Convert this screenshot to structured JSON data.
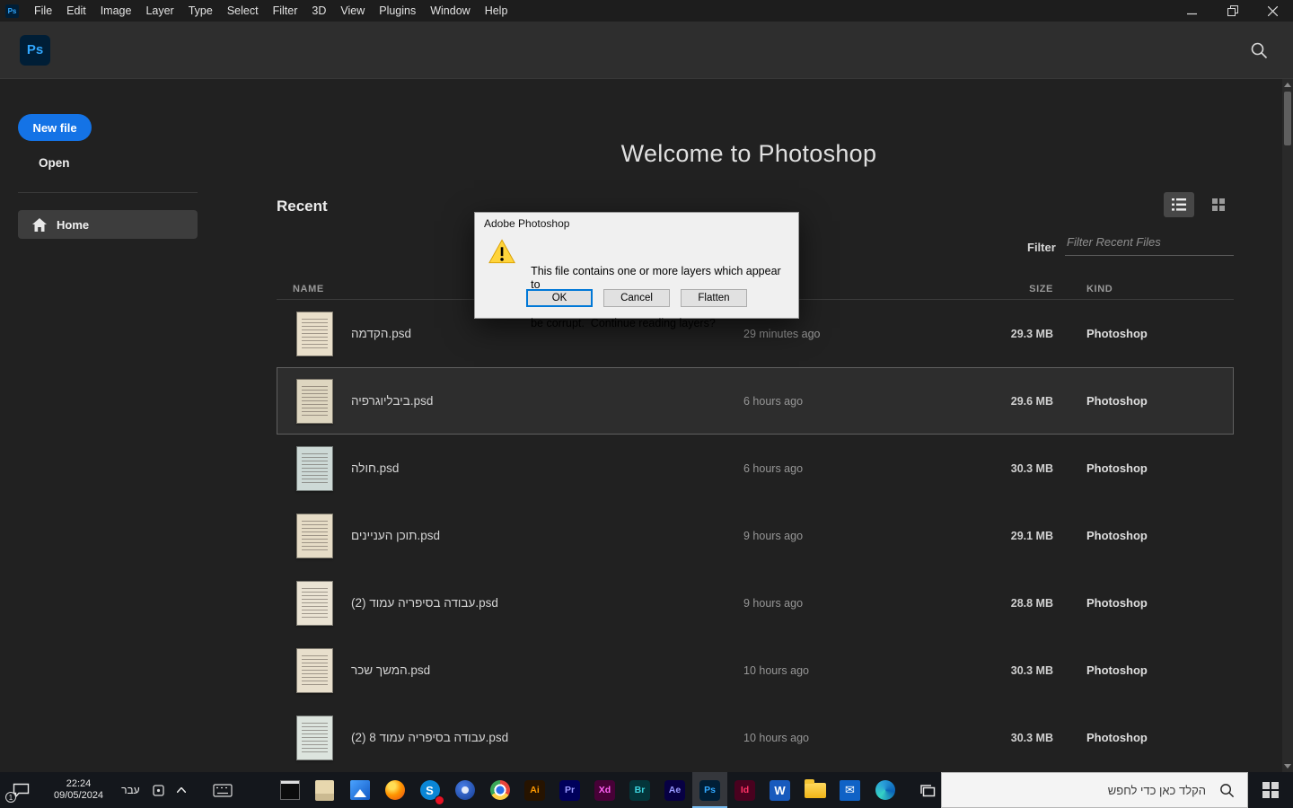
{
  "menu_bar": {
    "app_icon": "Ps",
    "items": [
      "File",
      "Edit",
      "Image",
      "Layer",
      "Type",
      "Select",
      "Filter",
      "3D",
      "View",
      "Plugins",
      "Window",
      "Help"
    ]
  },
  "header": {
    "logo": "Ps"
  },
  "sidebar": {
    "new_file_label": "New file",
    "open_label": "Open",
    "home_label": "Home"
  },
  "main": {
    "welcome_title": "Welcome to Photoshop",
    "recent_heading": "Recent",
    "filter_label": "Filter",
    "filter_placeholder": "Filter Recent Files",
    "columns": {
      "name": "NAME",
      "size": "SIZE",
      "kind": "KIND"
    },
    "selected_index": 1,
    "files": [
      {
        "name": "הקדמה.psd",
        "opened": "29 minutes ago",
        "size": "29.3 MB",
        "kind": "Photoshop",
        "thumb_color": "#e9dfca"
      },
      {
        "name": "ביבליוגרפיה.psd",
        "opened": "6 hours ago",
        "size": "29.6 MB",
        "kind": "Photoshop",
        "thumb_color": "#ded6c0"
      },
      {
        "name": "חולה.psd",
        "opened": "6 hours ago",
        "size": "30.3 MB",
        "kind": "Photoshop",
        "thumb_color": "#cdd9d6"
      },
      {
        "name": "תוכן העניינים.psd",
        "opened": "9 hours ago",
        "size": "29.1 MB",
        "kind": "Photoshop",
        "thumb_color": "#e6dcc6"
      },
      {
        "name": "עבודה בסיפריה עמוד (2).psd",
        "opened": "9 hours ago",
        "size": "28.8 MB",
        "kind": "Photoshop",
        "thumb_color": "#eae3d3"
      },
      {
        "name": "המשך שכר.psd",
        "opened": "10 hours ago",
        "size": "30.3 MB",
        "kind": "Photoshop",
        "thumb_color": "#e8dfcc"
      },
      {
        "name": "עבודה בסיפריה עמוד 8 (2).psd",
        "opened": "10 hours ago",
        "size": "30.3 MB",
        "kind": "Photoshop",
        "thumb_color": "#dce4de"
      }
    ]
  },
  "dialog": {
    "title": "Adobe Photoshop",
    "message_line1": "This file contains one or more layers which appear to",
    "message_line2": "be corrupt.  Continue reading layers?",
    "buttons": {
      "ok": "OK",
      "cancel": "Cancel",
      "flatten": "Flatten"
    }
  },
  "taskbar": {
    "clock": {
      "time": "22:24",
      "date": "09/05/2024"
    },
    "language": "עבר",
    "notification_count": "1",
    "search_placeholder": "הקלד כאן כדי לחפש",
    "apps": [
      {
        "id": "cmd",
        "label": ""
      },
      {
        "id": "notes",
        "label": ""
      },
      {
        "id": "photos",
        "label": ""
      },
      {
        "id": "firefox",
        "label": ""
      },
      {
        "id": "skype",
        "label": "S"
      },
      {
        "id": "blue-app",
        "label": ""
      },
      {
        "id": "chrome",
        "label": ""
      },
      {
        "id": "illustrator",
        "label": "Ai"
      },
      {
        "id": "premiere",
        "label": "Pr"
      },
      {
        "id": "xd",
        "label": "Xd"
      },
      {
        "id": "bridge",
        "label": "Br"
      },
      {
        "id": "after-effects",
        "label": "Ae"
      },
      {
        "id": "photoshop",
        "label": "Ps",
        "active": true
      },
      {
        "id": "indesign",
        "label": "Id"
      },
      {
        "id": "word",
        "label": "W"
      },
      {
        "id": "explorer",
        "label": ""
      },
      {
        "id": "mail",
        "label": "✉"
      },
      {
        "id": "edge",
        "label": ""
      },
      {
        "id": "task-view",
        "label": ""
      }
    ]
  },
  "colors": {
    "accent_blue": "#1473e6",
    "dialog_focus_blue": "#0078d7",
    "ps_logo_bg": "#001e36",
    "ps_logo_fg": "#31a8ff",
    "warning_yellow": "#ffd43b"
  }
}
